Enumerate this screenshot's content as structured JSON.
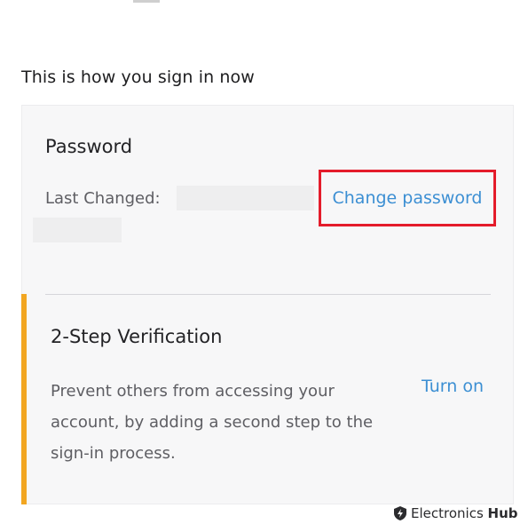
{
  "section": {
    "heading": "This is how you sign in now"
  },
  "password": {
    "title": "Password",
    "last_changed_label": "Last Changed:",
    "change_link": "Change password",
    "colors": {
      "link": "#3c8fd3",
      "highlight_box": "#e41c2b"
    }
  },
  "two_step": {
    "title": "2-Step Verification",
    "description": "Prevent others from accessing your account, by adding a second step to the sign-in process.",
    "turn_on_link": "Turn on",
    "accent_color": "#f2a621"
  },
  "watermark": {
    "icon": "shield-bolt-icon",
    "brand_prefix": "Electronics",
    "brand_suffix": "Hub"
  }
}
